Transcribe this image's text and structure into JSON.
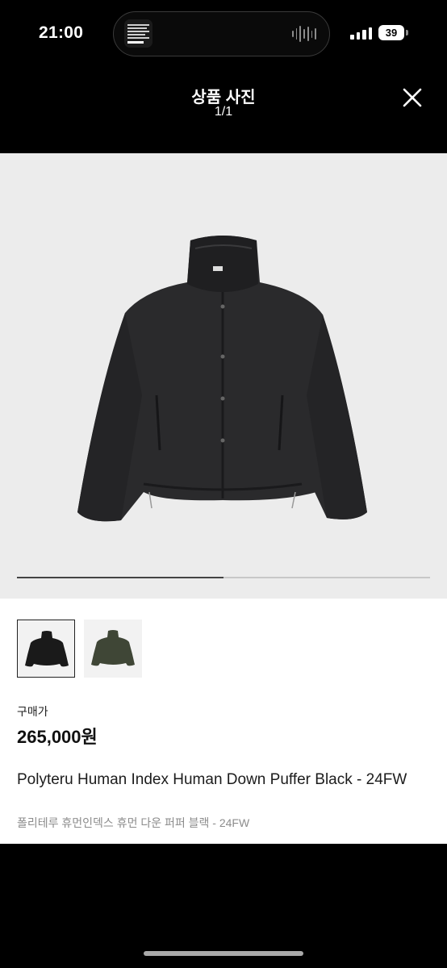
{
  "status_bar": {
    "time": "21:00",
    "battery": "39",
    "now_playing_icon": "album-art-icon",
    "audio_icon": "waveform-icon",
    "signal_icon": "cellular-signal-icon"
  },
  "header": {
    "title": "상품 사진",
    "counter": "1/1",
    "close_icon": "close-icon"
  },
  "gallery": {
    "main_image": "black-puffer-jacket-photo",
    "progress": 0.5,
    "thumbnails": [
      {
        "name": "black-jacket-thumbnail",
        "color": "#1a1a1a",
        "selected": true
      },
      {
        "name": "olive-jacket-thumbnail",
        "color": "#3f4636",
        "selected": false
      }
    ]
  },
  "product": {
    "price_label": "구매가",
    "price": "265,000원",
    "name": "Polyteru Human Index Human Down Puffer Black - 24FW",
    "name_korean": "폴리테루 휴먼인덱스 휴먼 다운 퍼퍼 블랙 - 24FW"
  },
  "colors": {
    "background": "#000000",
    "sheet": "#ffffff",
    "photo_bg": "#ececec",
    "muted_text": "#8c8c8c"
  }
}
